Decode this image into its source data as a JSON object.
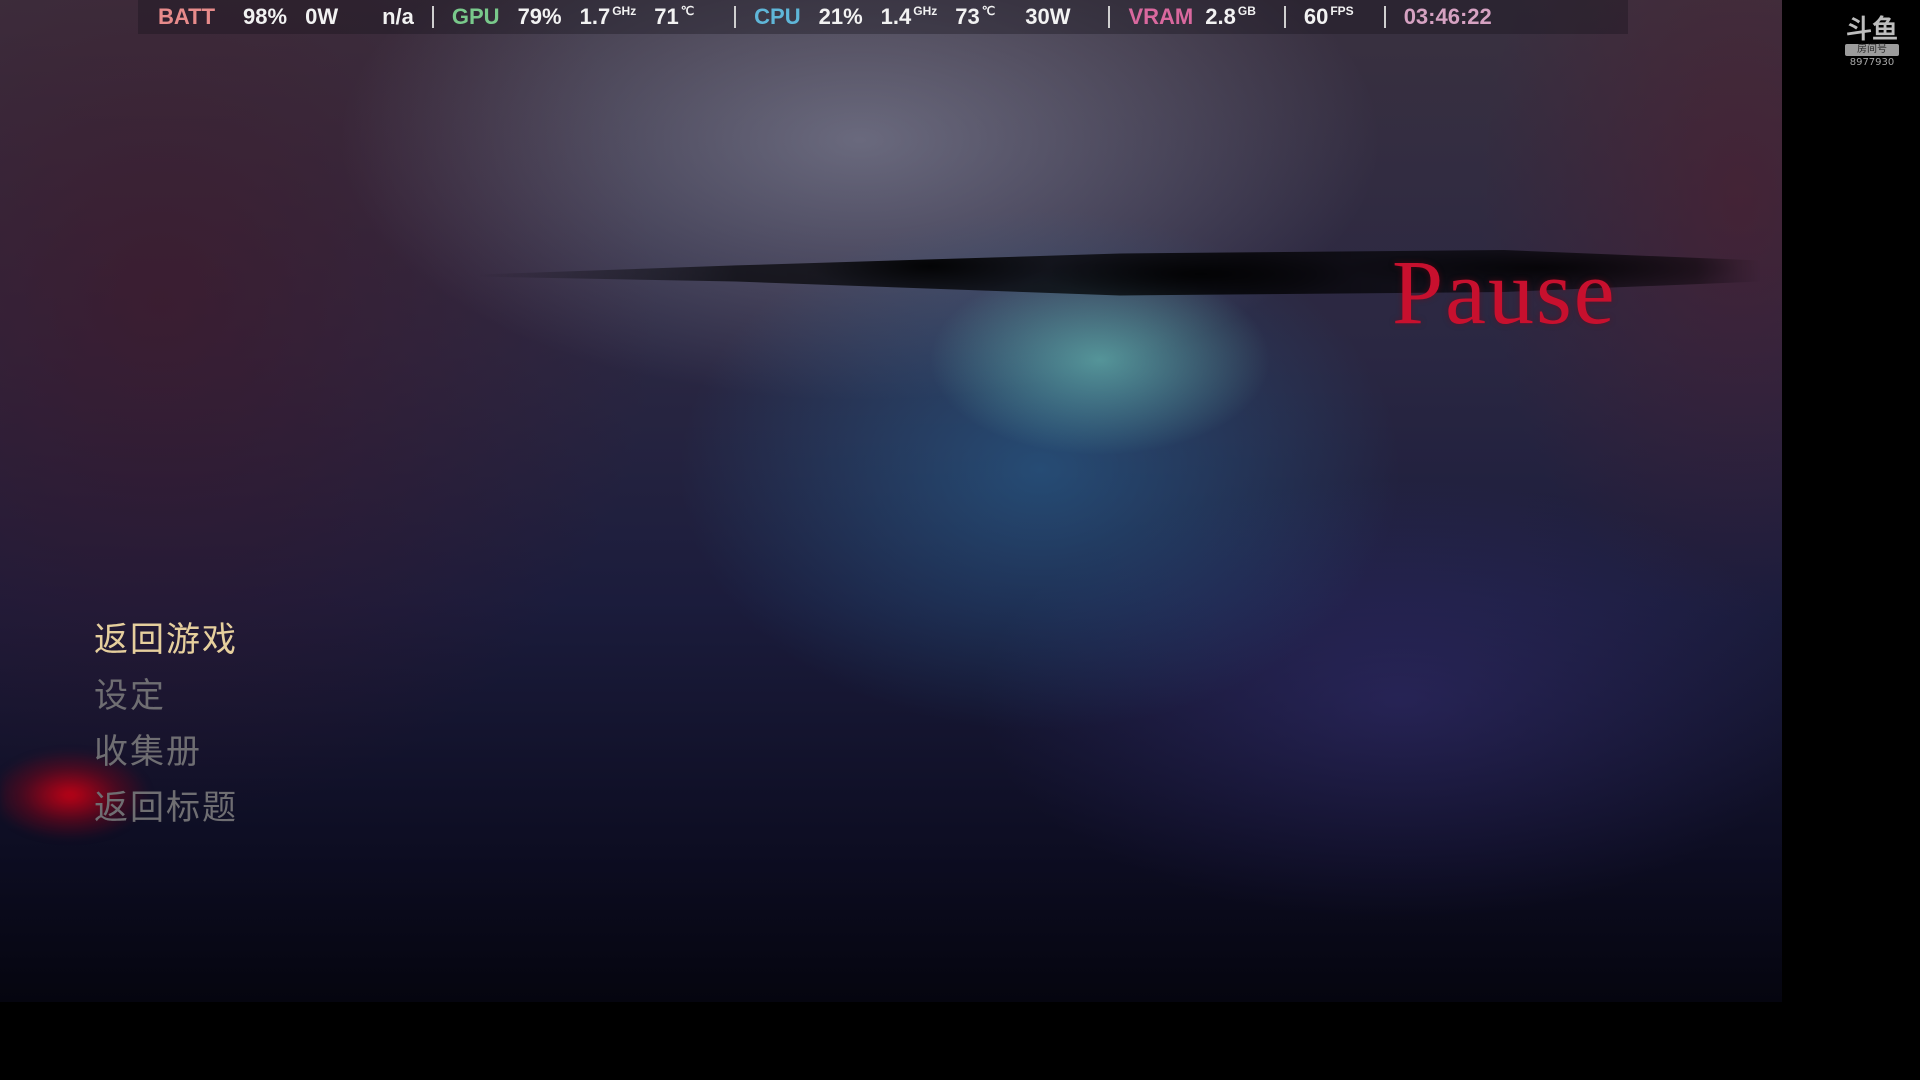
{
  "overlay": {
    "batt_label": "BATT",
    "batt_percent": "98%",
    "batt_power": "0W",
    "batt_extra": "n/a",
    "gpu_label": "GPU",
    "gpu_load": "79%",
    "gpu_clock": "1.7",
    "gpu_clock_unit": "GHz",
    "gpu_temp": "71",
    "gpu_temp_unit": "℃",
    "cpu_label": "CPU",
    "cpu_load": "21%",
    "cpu_clock": "1.4",
    "cpu_clock_unit": "GHz",
    "cpu_temp": "73",
    "cpu_temp_unit": "℃",
    "cpu_power": "30W",
    "vram_label": "VRAM",
    "vram_value": "2.8",
    "vram_unit": "GB",
    "fps_value": "60",
    "fps_unit": "FPS",
    "time": "03:46:22"
  },
  "pause": {
    "title": "Pause",
    "menu": [
      {
        "label": "返回游戏",
        "selected": true
      },
      {
        "label": "设定",
        "selected": false
      },
      {
        "label": "收集册",
        "selected": false
      },
      {
        "label": "返回标题",
        "selected": false
      }
    ]
  },
  "watermark": {
    "logo": "斗鱼",
    "tag": "房间号",
    "room_id": "8977930"
  },
  "colors": {
    "title": "#c8102e",
    "menu_selected": "#e6cf9d",
    "menu_normal": "#6f6e72"
  }
}
